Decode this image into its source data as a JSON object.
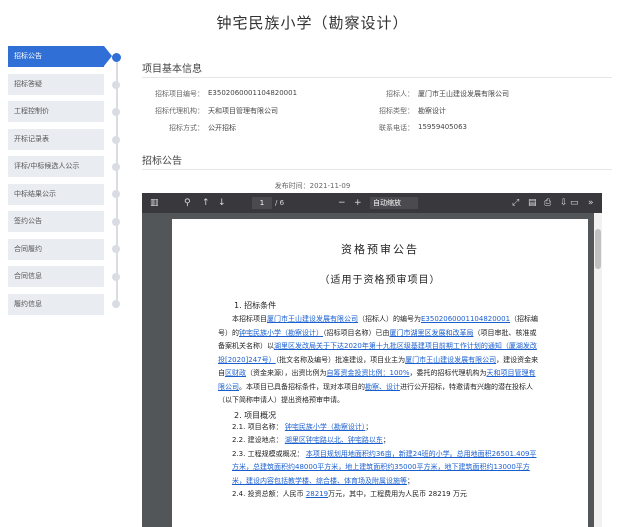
{
  "page_title": "钟宅民族小学（勘察设计）",
  "sidebar": {
    "items": [
      {
        "label": "招标公告",
        "active": true
      },
      {
        "label": "招标答疑"
      },
      {
        "label": "工程控制价"
      },
      {
        "label": "开标记录表"
      },
      {
        "label": "评标/中标候选人公示"
      },
      {
        "label": "中标结果公示"
      },
      {
        "label": "签约公告"
      },
      {
        "label": "合同履约"
      },
      {
        "label": "合同信息"
      },
      {
        "label": "履约信息"
      }
    ]
  },
  "project_info": {
    "section_title": "项目基本信息",
    "rows": [
      {
        "l1": "招标项目编号：",
        "v1": "E3502060001104820001",
        "l2": "招标人：",
        "v2": "厦门市王山建设发展有限公司"
      },
      {
        "l1": "招标代理机构：",
        "v1": "天和项目管理有限公司",
        "l2": "招标类型：",
        "v2": "勘察设计"
      },
      {
        "l1": "招标方式：",
        "v1": "公开招标",
        "l2": "联系电话：",
        "v2": "15959405063"
      }
    ]
  },
  "announcement": {
    "section_title": "招标公告",
    "publish_time": "发布时间：2021-11-09"
  },
  "pdf_viewer": {
    "page_current": "1",
    "page_total": "/ 6",
    "zoom": "自动缩放"
  },
  "document": {
    "title": "资格预审公告",
    "subtitle": "（适用于资格预审项目）",
    "heading1": "1. 招标条件",
    "para1_parts": [
      {
        "text": "本招标项目",
        "u": false
      },
      {
        "text": "厦门市王山建设发展有限公司",
        "u": true
      },
      {
        "text": "（招标人）的编号为",
        "u": false
      },
      {
        "text": "E3502060001104820001",
        "u": true
      },
      {
        "text": "（招标编号）的",
        "u": false
      },
      {
        "text": "钟宅民族小学（勘察设计）",
        "u": true
      },
      {
        "text": "（招标项目名称）已由",
        "u": false
      },
      {
        "text": "厦门市湖里区发展和改革局",
        "u": true
      },
      {
        "text": "（项目审批、核准或备案机关名称）以",
        "u": false
      },
      {
        "text": "湖里区发改局关于下达2020年第十九批区级基建项目前期工作计划的通知（厦湖发改投[2020]247号）",
        "u": true
      },
      {
        "text": "（批文名称及编号）批准建设，项目业主为",
        "u": false
      },
      {
        "text": "厦门市王山建设发展有限公司",
        "u": true
      },
      {
        "text": "，建设资金来自",
        "u": false
      },
      {
        "text": "区财政",
        "u": true
      },
      {
        "text": "（资金来源），出资比例为",
        "u": false
      },
      {
        "text": "自筹资金投资比例：100%",
        "u": true
      },
      {
        "text": "，委托的招标代理机构为",
        "u": false
      },
      {
        "text": "天和项目管理有限公司",
        "u": true
      },
      {
        "text": "。本项目已具备招标条件，现对本项目的",
        "u": false
      },
      {
        "text": "勘察、设计",
        "u": true
      },
      {
        "text": "进行公开招标，特邀请有兴趣的潜在投标人（以下简称申请人）提出资格预审申请。",
        "u": false
      }
    ],
    "heading2": "2. 项目概况",
    "items": [
      {
        "num": "2.1.",
        "label": "项目名称：",
        "value": "钟宅民族小学（勘察设计）",
        "tail": "；"
      },
      {
        "num": "2.2.",
        "label": "建设地点：",
        "value": "湖里区钟宅路以北、钟宅路以东",
        "tail": "；"
      },
      {
        "num": "2.3.",
        "label": "工程规模或概况：",
        "value": "本项目规划用地面积约36亩，新建24班的小学。总用地面积26501.409平方米，总建筑面积约48000平方米，地上建筑面积约35000平方米，地下建筑面积约13000平方米，建设内容包括教学楼、综合楼、体育场及附属设施等",
        "tail": "；"
      },
      {
        "num": "2.4.",
        "label": "投资总额：人民币",
        "value": "28219",
        "tail": "万元，其中，工程费用为人民币 28219 万元"
      }
    ]
  }
}
